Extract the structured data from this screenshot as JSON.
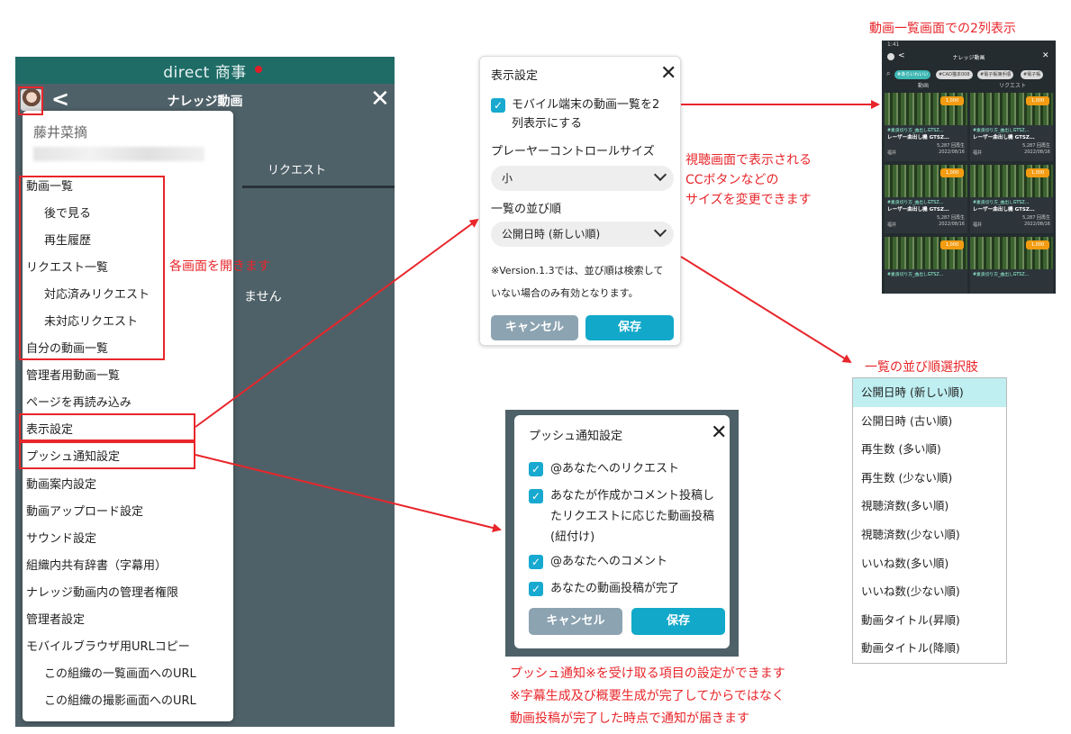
{
  "phone": {
    "brand": "direct 商事",
    "title": "ナレッジ動画",
    "back_glyph": "<",
    "close_glyph": "✕",
    "tab_request": "リクエスト",
    "empty_text": "ません"
  },
  "menu": {
    "user_name": "藤井菜摘",
    "items": [
      {
        "label": "動画一覧",
        "sub": false
      },
      {
        "label": "後で見る",
        "sub": true
      },
      {
        "label": "再生履歴",
        "sub": true
      },
      {
        "label": "リクエスト一覧",
        "sub": false
      },
      {
        "label": "対応済みリクエスト",
        "sub": true
      },
      {
        "label": "未対応リクエスト",
        "sub": true
      },
      {
        "label": "自分の動画一覧",
        "sub": false
      },
      {
        "label": "管理者用動画一覧",
        "sub": false
      },
      {
        "label": "ページを再読み込み",
        "sub": false
      },
      {
        "label": "表示設定",
        "sub": false
      },
      {
        "label": "プッシュ通知設定",
        "sub": false
      },
      {
        "label": "動画案内設定",
        "sub": false
      },
      {
        "label": "動画アップロード設定",
        "sub": false
      },
      {
        "label": "サウンド設定",
        "sub": false
      },
      {
        "label": "組織内共有辞書（字幕用）",
        "sub": false
      },
      {
        "label": "ナレッジ動画内の管理者権限",
        "sub": false
      },
      {
        "label": "管理者設定",
        "sub": false
      },
      {
        "label": "モバイルブラウザ用URLコピー",
        "sub": false
      },
      {
        "label": "この組織の一覧画面へのURL",
        "sub": true
      },
      {
        "label": "この組織の撮影画面へのURL",
        "sub": true
      }
    ]
  },
  "display_dialog": {
    "title": "表示設定",
    "close_glyph": "✕",
    "checkbox_label_1": "モバイル端末の動画一覧を2",
    "checkbox_label_2": "列表示にする",
    "checkbox_checked": true,
    "player_size_label": "プレーヤーコントロールサイズ",
    "player_size_value": "小",
    "sort_label": "一覧の並び順",
    "sort_value": "公開日時 (新しい順)",
    "note_1": "※Version.1.3では、並び順は検索して",
    "note_2": "いない場合のみ有効となります。",
    "cancel": "キャンセル",
    "save": "保存"
  },
  "push_dialog": {
    "title": "プッシュ通知設定",
    "close_glyph": "✕",
    "options": [
      {
        "lines": [
          "@あなたへのリクエスト"
        ],
        "checked": true
      },
      {
        "lines": [
          "あなたが作成かコメント投稿し",
          "たリクエストに応じた動画投稿",
          "(紐付け)"
        ],
        "checked": true
      },
      {
        "lines": [
          "@あなたへのコメント"
        ],
        "checked": true
      },
      {
        "lines": [
          "あなたの動画投稿が完了"
        ],
        "checked": true
      }
    ],
    "cancel": "キャンセル",
    "save": "保存"
  },
  "sort_options": {
    "title": "一覧の並び順選択肢",
    "options": [
      "公開日時 (新しい順)",
      "公開日時 (古い順)",
      "再生数 (多い順)",
      "再生数 (少ない順)",
      "視聴済数(多い順)",
      "視聴済数(少ない順)",
      "いいね数(多い順)",
      "いいね数(少ない順)",
      "動画タイトル(昇順)",
      "動画タイトル(降順)"
    ],
    "selected_index": 0
  },
  "preview": {
    "title": "動画一覧画面での2列表示",
    "time": "1:41",
    "header_title": "ナレッジ動画",
    "chips": [
      "#あらいわいい",
      "#CAD猫本008",
      "#電子帳簿手順",
      "#電子帳"
    ],
    "tab_left": "動画",
    "tab_right": "リクエスト",
    "cards": [
      {
        "line1": "#素良切り方_曲出しGTSZ…",
        "line2": "レーザー曲出し機 GTSZ…",
        "views": "5,287 回再生",
        "author": "福井",
        "date": "2022/08/16",
        "likes": "1,000"
      },
      {
        "line1": "#素良切り方_曲出しGTSZ…",
        "line2": "レーザー曲出し機 GTSZ…",
        "views": "5,287 回再生",
        "author": "福井",
        "date": "2022/08/16",
        "likes": "1,000"
      },
      {
        "line1": "#素良切り方_曲出しGTSZ…",
        "line2": "レーザー曲出し機 GTSZ…",
        "views": "5,287 回再生",
        "author": "福井",
        "date": "2022/08/16",
        "likes": "1,000"
      },
      {
        "line1": "#素良切り方_曲出しGTSZ…",
        "line2": "レーザー曲出し機 GTSZ…",
        "views": "5,287 回再生",
        "author": "福井",
        "date": "2022/08/16",
        "likes": "1,000"
      },
      {
        "line1": "#素良切り方_曲出しGTSZ…",
        "line2": "",
        "views": "",
        "author": "",
        "date": "",
        "likes": "1,000"
      },
      {
        "line1": "#素良切り方_曲出しGTSZ…",
        "line2": "",
        "views": "",
        "author": "",
        "date": "",
        "likes": "1,000"
      }
    ]
  },
  "annotations": {
    "open_screens": "各画面を開きます",
    "cc_1": "視聴画面で表示される",
    "cc_2": "CCボタンなどの",
    "cc_3": "サイズを変更できます",
    "push_1": "プッシュ通知※を受け取る項目の設定ができます",
    "push_2": "※字幕生成及び概要生成が完了してからではなく",
    "push_3": "動画投稿が完了した時点で通知が届きます"
  },
  "colors": {
    "annotation_red": "#e8262b",
    "brand_teal": "#1f6c67",
    "accent_blue": "#17a9cf",
    "cancel_grey": "#8ca3b1",
    "selected_row": "#bfeff1"
  }
}
